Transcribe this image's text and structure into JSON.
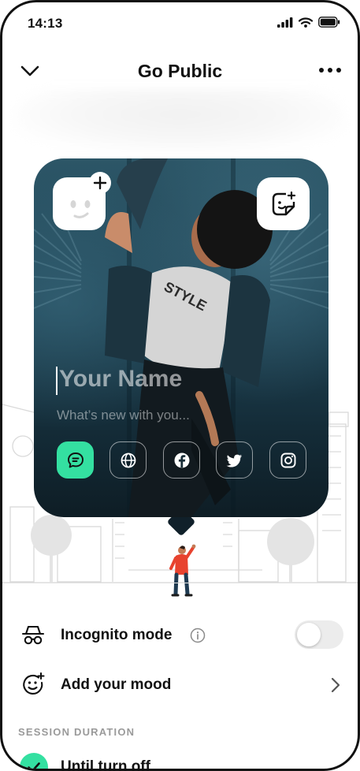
{
  "status_bar": {
    "time": "14:13"
  },
  "header": {
    "title": "Go Public"
  },
  "card": {
    "name_placeholder": "Your Name",
    "status_placeholder": "What’s new with you...",
    "tshirt_text": "STYLE"
  },
  "socials": [
    {
      "icon": "message-icon",
      "active": true
    },
    {
      "icon": "globe-icon",
      "active": false
    },
    {
      "icon": "facebook-icon",
      "active": false
    },
    {
      "icon": "twitter-icon",
      "active": false
    },
    {
      "icon": "instagram-icon",
      "active": false
    }
  ],
  "settings": {
    "incognito_label": "Incognito mode",
    "incognito_enabled": false,
    "mood_label": "Add your mood"
  },
  "session": {
    "heading": "SESSION DURATION",
    "selected_option": "Until turn off"
  },
  "colors": {
    "accent": "#34e0a1"
  }
}
